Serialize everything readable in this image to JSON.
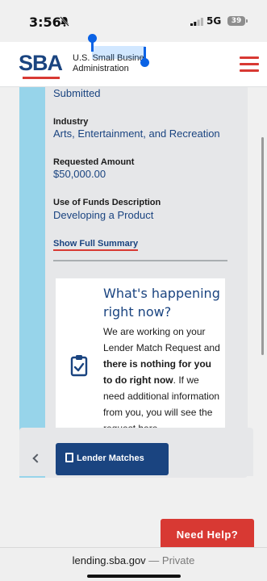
{
  "status_bar": {
    "time": "3:56",
    "network": "5G",
    "battery": "39"
  },
  "header": {
    "logo_text": "SBA",
    "org_line1": "U.S. Small Busine",
    "org_line2": "Administration"
  },
  "details": {
    "status_value": "Submitted",
    "industry_label": "Industry",
    "industry_value": "Arts, Entertainment, and Recreation",
    "amount_label": "Requested Amount",
    "amount_value": "$50,000.00",
    "funds_label": "Use of Funds Description",
    "funds_value": "Developing a Product",
    "show_summary": "Show Full Summary"
  },
  "info": {
    "title": "What's happening right now?",
    "body_part1": "We are working on your Lender Match Request and ",
    "body_bold": "there is nothing for you to do right now",
    "body_part2": ". If we need additional information from you, you will see the request here."
  },
  "bottom": {
    "lender_matches": "Lender Matches",
    "need_help": "Need Help?"
  },
  "browser": {
    "domain": "lending.sba.gov",
    "separator": " — ",
    "mode": "Private"
  },
  "colors": {
    "brand_blue": "#1a4480",
    "brand_red": "#d83933",
    "accent_cyan": "#97d4ea"
  }
}
